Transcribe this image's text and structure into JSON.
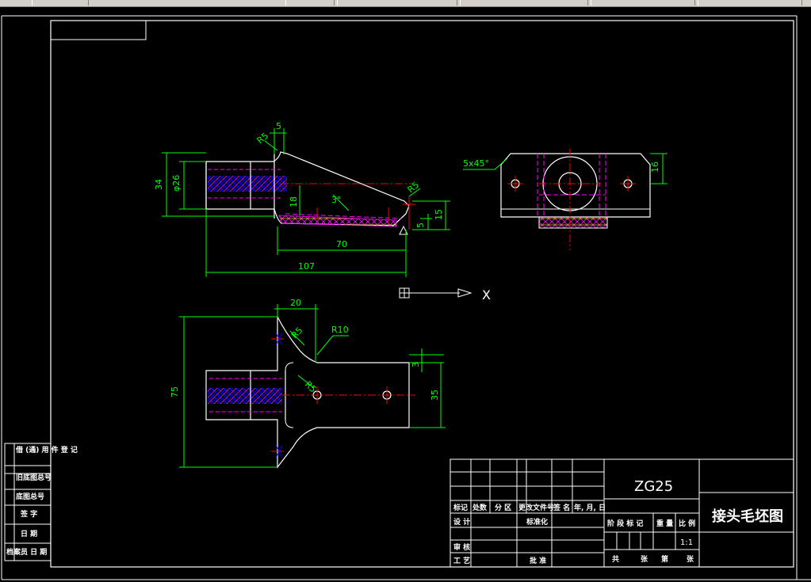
{
  "colors": {
    "background": "#000000",
    "outline": "#ffffff",
    "dimension": "#00ff00",
    "centerline": "#ff0000",
    "hidden": "#ff00ff",
    "hatch_a": "#0000ff",
    "hatch_b": "#ff00ff",
    "hatch_c": "#ffff00",
    "axis": "#ffffff"
  },
  "dimensions": {
    "d5_top": "5",
    "r5_topleft": "R5",
    "d34": "34",
    "phi26": "φ26",
    "d18": "18",
    "d3": "3°",
    "r5_right": "R5",
    "d15": "15",
    "d5_right": "5",
    "d70": "70",
    "d107": "107",
    "chamfer": "5x45°",
    "d16": "16",
    "d20": "20",
    "r10": "R10",
    "r5_top_bottom": "R5",
    "r5_inner": "R5",
    "d75": "75",
    "d3_small": "3",
    "d35": "35"
  },
  "axis": {
    "x_label": "X"
  },
  "title_block": {
    "material": "ZG25",
    "drawing_title": "接头毛坯图",
    "scale_value": "1:1",
    "row_labels": {
      "mark": "标记",
      "count": "处数",
      "zone": "分 区",
      "change_doc": "更改文件号",
      "sign": "签 名",
      "date": "年, 月, 日",
      "design": "设 计",
      "standard": "标准化",
      "review": "审 核",
      "process": "工 艺",
      "approve": "批 准"
    },
    "stage_labels": {
      "stage_mark": "阶 段 标 记",
      "weight": "重 量",
      "scale": "比 例"
    },
    "sheet_labels": {
      "total": "共",
      "sheets": "张",
      "no": "第",
      "sheet": "张"
    }
  },
  "side_strip": {
    "cells": [
      "借 (通) 用\n件 登 记",
      "旧底图总号",
      "底图总号",
      "签 字",
      "日 期",
      "档案员 日 期"
    ]
  }
}
